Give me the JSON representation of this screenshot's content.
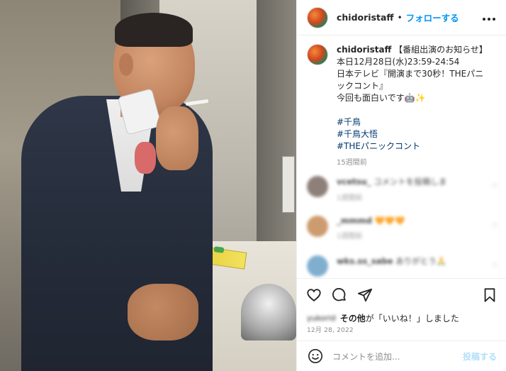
{
  "post": {
    "username": "chidoristaff",
    "follow_label": "フォローする",
    "more_icon": "more-horizontal-icon"
  },
  "caption": {
    "username": "chidoristaff",
    "lines": [
      "【番組出演のお知らせ】",
      "本日12月28日(水)23:59-24:54",
      "日本テレビ『開演まで30秒！THEパニ",
      "ックコント』",
      "今回も面白いです🤖✨"
    ],
    "hashtags": [
      "#千鳥",
      "#千鳥大悟",
      "#THEパニックコント"
    ],
    "time_ago": "15週間前"
  },
  "comments": [
    {
      "username": "vcetsu_",
      "text": "コメントを投稿しま",
      "meta": "1週間前",
      "avatar_color": "#7a6a62"
    },
    {
      "username": "_mmmd",
      "text": "🧡🧡🧡",
      "meta": "1週間前",
      "avatar_color": "#c48a55"
    },
    {
      "username": "wks.ss_sabe",
      "text": "ありがとう🙏",
      "meta": "",
      "avatar_color": "#6aa0c7"
    }
  ],
  "actions": {
    "like_icon": "heart-icon",
    "comment_icon": "comment-icon",
    "share_icon": "share-icon",
    "save_icon": "bookmark-icon"
  },
  "likes": {
    "liker": "yukorid",
    "others_label": "その他",
    "suffix": "が「いいね！」しました"
  },
  "date": "12月 28, 2022",
  "add_comment": {
    "placeholder": "コメントを追加...",
    "post_label": "投稿する",
    "emoji_icon": "smiley-icon"
  },
  "colors": {
    "accent": "#0095f6",
    "hashtag": "#00376b",
    "muted": "#8e8e8e",
    "post_disabled": "#b2dffc"
  }
}
